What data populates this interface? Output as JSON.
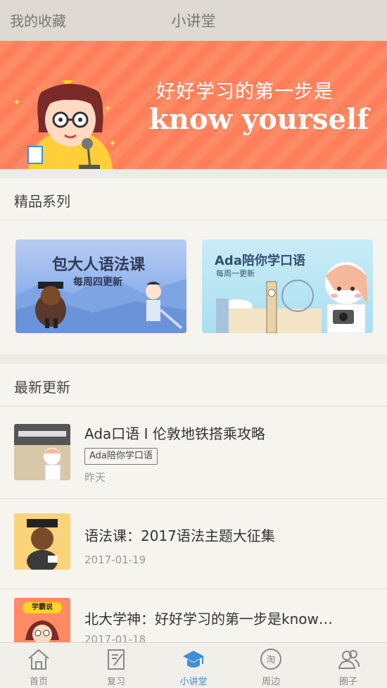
{
  "topbar": {
    "left_label": "我的收藏",
    "title": "小讲堂"
  },
  "banner": {
    "badge": "学霸说",
    "line1": "好好学习的第一步是",
    "line2": "know yourself"
  },
  "series": {
    "heading": "精品系列",
    "cards": [
      {
        "title": "包大人语法课",
        "subtitle": "每周四更新"
      },
      {
        "title": "Ada陪你学口语",
        "subtitle": "每周一更新"
      }
    ]
  },
  "latest": {
    "heading": "最新更新",
    "items": [
      {
        "title": "Ada口语 I 伦敦地铁搭乘攻略",
        "tag": "Ada陪你学口语",
        "date": "昨天"
      },
      {
        "title": "语法课：2017语法主题大征集",
        "date": "2017-01-19"
      },
      {
        "title": "北大学神：好好学习的第一步是know…",
        "date": "2017-01-18"
      }
    ]
  },
  "tabs": [
    {
      "label": "首页",
      "icon": "home-icon",
      "active": false
    },
    {
      "label": "复习",
      "icon": "notebook-icon",
      "active": false
    },
    {
      "label": "小讲堂",
      "icon": "graduation-cap-icon",
      "active": true
    },
    {
      "label": "周边",
      "icon": "taobao-icon",
      "active": false
    },
    {
      "label": "圈子",
      "icon": "people-icon",
      "active": false
    }
  ],
  "colors": {
    "accent": "#3d8fd6",
    "banner": "#ff8660",
    "badge": "#ffd324"
  }
}
